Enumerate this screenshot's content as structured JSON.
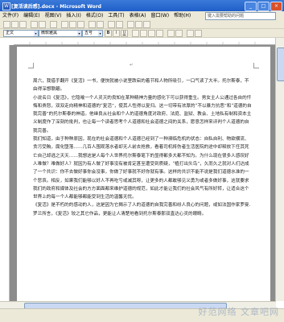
{
  "window": {
    "title": "[复活读后感].docx - Microsoft Word",
    "app_icon": "W"
  },
  "window_buttons": [
    "_",
    "□",
    "×"
  ],
  "menu": [
    "文件(F)",
    "编辑(E)",
    "视图(V)",
    "插入(I)",
    "格式(O)",
    "工具(T)",
    "表格(A)",
    "窗口(W)",
    "帮助(H)"
  ],
  "help_box": {
    "placeholder": "键入需要帮助的问题"
  },
  "format_toolbar": {
    "style": "正文",
    "font": "微软雅黑",
    "size": "五号",
    "bold": "B",
    "italic": "I",
    "underline": "U"
  },
  "document": {
    "paragraphs": [
      "周六，我借手翻开《复活》一书，便快就被小说里跌宕的着节和人物所吸引，一口气读了大半。托尔斯泰，不由得深想联翩。",
      "小说名日《复活》，它隐喻一个人灵灭的良知在某种精神力量的感化下可以获得重生。男女主人公通过各自的忏悔和贵怒，双双走向精神和道德的“复活”，使其人性得以复归。这一切带有浓厚的“不以暴力抗恶”和“道德的自我完善”的托尔斯泰的神道。他继良从社会和个人的道德角度对政府、法庭、监狱、教会、土地私有制和资本主义制度作了深刻的批判，也让每一个读者思考个人道德和社会道德之间的关系，愿意怎样来评判个人道德的自我完善。",
      "我们知道，由于种种原因，现在的社会道德和个人道德已经到了一种濒临危机的状态：自私自利、物欲横流、贪污受贿，腐化堕落……几百人围观落水者却无人前去抢救，看着司机将伤者生活医院的途中却释放下任其死亡自己却逃之天天……我想这是人每个人世界托尔斯泰笔下的显得都多大都不知为。为什么现在很多人感叹好人难做？难做好人？就因为有人做了好事没有被肯定甚至遭受到质疑，“植打出头鸟”，久而久之就对人们达成了一个共识：你不去做好事你会没事，你做了好事就不好你就有事。这样的共识不能不说是我们道德水准的一个悲哀。相反，如果我们能够以好人不再吃亏或减其呀，让更多的人都敢够见义勇为或者多做好事，这就要求我们的政府和媒体及社会的方方面面都来维护道德的规范，如此才能让我们的社会风气有所好转，让适合这个世界上的每一个人都能够都能受到生活的温馨无忧。",
      "《复活》是不朽的的感动的人，这是因为它揭示了人的道德的自我完善和纷人良心的问题，或如法国作家罗曼.罗兰所言，《复活》较之其它作品，更能让人清楚地看到托尔斯泰那双直达心灵的眼睛。"
    ]
  },
  "watermark": "好范网络  文章吧网"
}
